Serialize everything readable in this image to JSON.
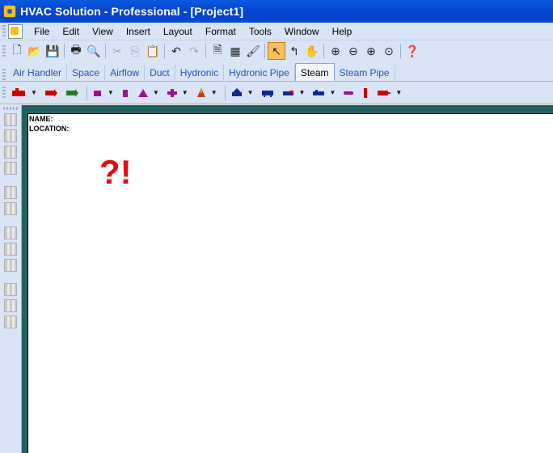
{
  "window": {
    "title": "HVAC Solution - Professional - [Project1]"
  },
  "menu": [
    "File",
    "Edit",
    "View",
    "Insert",
    "Layout",
    "Format",
    "Tools",
    "Window",
    "Help"
  ],
  "toolbar": {
    "buttons": [
      {
        "name": "new-icon",
        "glyph": "🗋"
      },
      {
        "name": "open-icon",
        "glyph": "📂"
      },
      {
        "name": "save-icon",
        "glyph": "💾"
      },
      {
        "name": "print-icon",
        "glyph": "🖶"
      },
      {
        "name": "print-preview-icon",
        "glyph": "🔍"
      },
      {
        "name": "cut-icon",
        "glyph": "✂"
      },
      {
        "name": "copy-icon",
        "glyph": "⎘"
      },
      {
        "name": "paste-icon",
        "glyph": "📋"
      },
      {
        "name": "undo-icon",
        "glyph": "↶"
      },
      {
        "name": "redo-icon",
        "glyph": "↷"
      },
      {
        "name": "properties-icon",
        "glyph": "🗎"
      },
      {
        "name": "calculator-icon",
        "glyph": "▦"
      },
      {
        "name": "format-painter-icon",
        "glyph": "🖌"
      },
      {
        "name": "select-pointer-icon",
        "glyph": "↖"
      },
      {
        "name": "connector-icon",
        "glyph": "↰"
      },
      {
        "name": "pan-hand-icon",
        "glyph": "✋"
      },
      {
        "name": "zoom-in-icon",
        "glyph": "⊕"
      },
      {
        "name": "zoom-out-icon",
        "glyph": "⊖"
      },
      {
        "name": "zoom-fit-icon",
        "glyph": "⊕"
      },
      {
        "name": "zoom-page-icon",
        "glyph": "⊙"
      },
      {
        "name": "help-icon",
        "glyph": "❓"
      }
    ]
  },
  "tabs": [
    "Air Handler",
    "Space",
    "Airflow",
    "Duct",
    "Hydronic",
    "Hydronic Pipe",
    "Steam",
    "Steam Pipe"
  ],
  "selected_tab": "Steam",
  "canvas": {
    "name_label": "NAME:",
    "location_label": "LOCATION:",
    "symbol": "?!"
  },
  "colors": {
    "title_bar": "#0548d2",
    "toolbar_bg": "#d9e4f7",
    "frame": "#226060",
    "accent_red": "#e01010",
    "selected_tool": "#f8c060"
  }
}
